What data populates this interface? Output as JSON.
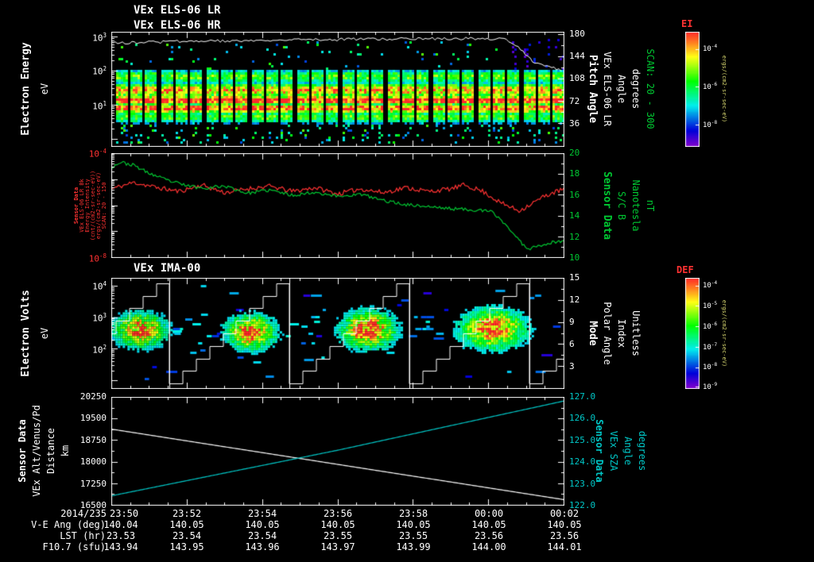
{
  "titles": {
    "els_lr": "VEx ELS-06 LR",
    "els_hr": "VEx ELS-06 HR",
    "ima": "VEx IMA-00"
  },
  "colors": {
    "white": "#ffffff",
    "green": "#00c832",
    "red": "#ff3232",
    "cyan": "#00c8c8",
    "bg": "#000000"
  },
  "labels": {
    "p1_left": [
      "Electron Energy",
      "eV"
    ],
    "p1_right": [
      "Pitch Angle",
      "VEx ELS-06 LR",
      "Angle",
      "degrees"
    ],
    "p1_right_scan": "SCAN: 20 - 300",
    "p2_left": [
      "Sensor Data",
      "VEx ELS-06 LR Bk",
      "Energy Intensity",
      "(cnt/(cm2-sr-sec-eV))",
      "ergs/(cm2-sr-sec-eV)",
      "SCAN: 20 - 150"
    ],
    "p2_right": [
      "Sensor Data",
      "S/C B",
      "Nanotesla",
      "nT"
    ],
    "p3_left": [
      "Electron Volts",
      "eV"
    ],
    "p3_right": [
      "Mode",
      "Polar Angle",
      "Index",
      "Unitless"
    ],
    "p4_left": [
      "Sensor Data",
      "VEx Alt/Venus/Pd",
      "Distance",
      "km"
    ],
    "p4_right": [
      "Sensor Data",
      "VEx SZA",
      "Angle",
      "degrees"
    ]
  },
  "colorbars": [
    {
      "title": "EI",
      "ticks": [
        "10^-4",
        "10^-6",
        "10^-8"
      ],
      "unit": "ergs/(cm2-sr-sec-eV)"
    },
    {
      "title": "DEF",
      "ticks": [
        "10^-4",
        "10^-5",
        "10^-6",
        "10^-7",
        "10^-8",
        "10^-9"
      ],
      "unit": "ergs/(cm2-sr-sec-eV)"
    }
  ],
  "time_axis": {
    "date": "2014/235",
    "ticks": [
      "23:50",
      "23:52",
      "23:54",
      "23:56",
      "23:58",
      "00:00",
      "00:02"
    ]
  },
  "table": {
    "rows": [
      {
        "label": "V-E Ang (deg)",
        "values": [
          "140.04",
          "140.05",
          "140.05",
          "140.05",
          "140.05",
          "140.05",
          "140.05"
        ]
      },
      {
        "label": "LST (hr)",
        "values": [
          "23.53",
          "23.54",
          "23.54",
          "23.55",
          "23.55",
          "23.56",
          "23.56"
        ]
      },
      {
        "label": "F10.7 (sfu)",
        "values": [
          "143.94",
          "143.95",
          "143.96",
          "143.97",
          "143.99",
          "144.00",
          "144.01"
        ]
      }
    ]
  },
  "chart_data": [
    {
      "type": "heatmap",
      "name": "els_electron_energy_spectrogram",
      "title": "VEx ELS-06 LR / VEx ELS-06 HR",
      "ylabel": "Electron Energy (eV)",
      "yscale": "log",
      "yticks": [
        "10^3",
        "10^2",
        "10^1"
      ],
      "right_ticks": [
        "180",
        "144",
        "108",
        "72",
        "36"
      ],
      "right_label": "Pitch Angle VEx ELS-06 LR Angle degrees SCAN: 20 - 300",
      "bands": [
        [
          0.38,
          0.045,
          0.62
        ],
        [
          0.5,
          0.05,
          0.85
        ],
        [
          0.585,
          0.03,
          1.08
        ],
        [
          0.655,
          0.035,
          0.95
        ],
        [
          0.73,
          0.042,
          0.6
        ]
      ],
      "gap_period": 19,
      "gap_width": 4,
      "trace": [
        [
          0,
          0.1
        ],
        [
          0.15,
          0.085
        ],
        [
          0.35,
          0.075
        ],
        [
          0.55,
          0.065
        ],
        [
          0.75,
          0.06
        ],
        [
          0.87,
          0.058
        ],
        [
          0.9,
          0.14
        ],
        [
          0.93,
          0.26
        ],
        [
          1,
          0.34
        ]
      ]
    },
    {
      "type": "line",
      "name": "els_intensity_and_bfield",
      "left_ticks": [
        "10^-4",
        "10^-8"
      ],
      "right_ticks": [
        "20",
        "18",
        "16",
        "14",
        "12",
        "10"
      ],
      "series": [
        {
          "name": "VEx ELS-06 LR Bk Energy Intensity (log10)",
          "color": "#ff3232",
          "ylim": [
            -8,
            -4
          ],
          "noise": 0.09,
          "seed": 11,
          "points": [
            [
              0,
              -5.35
            ],
            [
              0.05,
              -5.1
            ],
            [
              0.1,
              -5.3
            ],
            [
              0.15,
              -5.45
            ],
            [
              0.2,
              -5.2
            ],
            [
              0.25,
              -5.5
            ],
            [
              0.3,
              -5.35
            ],
            [
              0.35,
              -5.25
            ],
            [
              0.4,
              -5.45
            ],
            [
              0.45,
              -5.3
            ],
            [
              0.5,
              -5.55
            ],
            [
              0.55,
              -5.35
            ],
            [
              0.6,
              -5.5
            ],
            [
              0.65,
              -5.3
            ],
            [
              0.7,
              -5.45
            ],
            [
              0.75,
              -5.35
            ],
            [
              0.78,
              -5.2
            ],
            [
              0.82,
              -5.45
            ],
            [
              0.86,
              -5.9
            ],
            [
              0.9,
              -6.2
            ],
            [
              0.93,
              -5.9
            ],
            [
              0.96,
              -5.6
            ],
            [
              1,
              -5.35
            ]
          ]
        },
        {
          "name": "S/C B Nanotesla (nT)",
          "color": "#00c832",
          "ylim": [
            10,
            20
          ],
          "noise": 0.16,
          "seed": 23,
          "points": [
            [
              0,
              18.7
            ],
            [
              0.02,
              19.2
            ],
            [
              0.05,
              18.9
            ],
            [
              0.08,
              18.2
            ],
            [
              0.12,
              17.5
            ],
            [
              0.16,
              17.0
            ],
            [
              0.2,
              16.7
            ],
            [
              0.25,
              16.9
            ],
            [
              0.3,
              16.2
            ],
            [
              0.35,
              16.5
            ],
            [
              0.4,
              16.0
            ],
            [
              0.45,
              16.3
            ],
            [
              0.5,
              15.9
            ],
            [
              0.55,
              16.1
            ],
            [
              0.6,
              15.5
            ],
            [
              0.65,
              15.1
            ],
            [
              0.7,
              14.9
            ],
            [
              0.75,
              14.7
            ],
            [
              0.8,
              14.6
            ],
            [
              0.84,
              14.4
            ],
            [
              0.87,
              13.2
            ],
            [
              0.9,
              11.6
            ],
            [
              0.92,
              10.8
            ],
            [
              0.94,
              11.1
            ],
            [
              0.97,
              11.4
            ],
            [
              1,
              11.6
            ]
          ]
        }
      ]
    },
    {
      "type": "heatmap",
      "name": "ima_ion_spectrogram",
      "title": "VEx IMA-00",
      "ylabel": "Electron Volts (eV)",
      "yscale": "log",
      "yticks": [
        "10^4",
        "10^3",
        "10^2"
      ],
      "right_ticks": [
        "15",
        "12",
        "9",
        "6",
        "3"
      ],
      "right_label": "Mode Polar Angle Index Unitless",
      "blobs": [
        [
          0.062,
          0.46,
          0.048,
          0.13,
          0.92
        ],
        [
          0.305,
          0.48,
          0.046,
          0.13,
          0.98
        ],
        [
          0.565,
          0.46,
          0.05,
          0.14,
          1.0
        ],
        [
          0.84,
          0.45,
          0.06,
          0.15,
          0.97
        ]
      ],
      "staircase": {
        "period": 151,
        "reset": 73,
        "steps": 9
      },
      "dash_count": 46
    },
    {
      "type": "line",
      "name": "altitude_and_sza",
      "left_ticks": [
        "20250",
        "19500",
        "18750",
        "18000",
        "17250",
        "16500"
      ],
      "right_ticks": [
        "127.0",
        "126.0",
        "125.0",
        "124.0",
        "123.0",
        "122.0"
      ],
      "series": [
        {
          "name": "VEx Alt/Venus/Pd Distance (km)",
          "color": "#ffffff",
          "ylim": [
            16500,
            20250
          ],
          "noise": 0,
          "seed": 1,
          "points": [
            [
              0,
              19150
            ],
            [
              1,
              16680
            ]
          ]
        },
        {
          "name": "VEx SZA (degrees)",
          "color": "#00c8c8",
          "ylim": [
            122,
            127
          ],
          "noise": 0,
          "seed": 2,
          "points": [
            [
              0,
              122.42
            ],
            [
              0.5,
              124.55
            ],
            [
              1,
              126.85
            ]
          ]
        }
      ]
    }
  ]
}
